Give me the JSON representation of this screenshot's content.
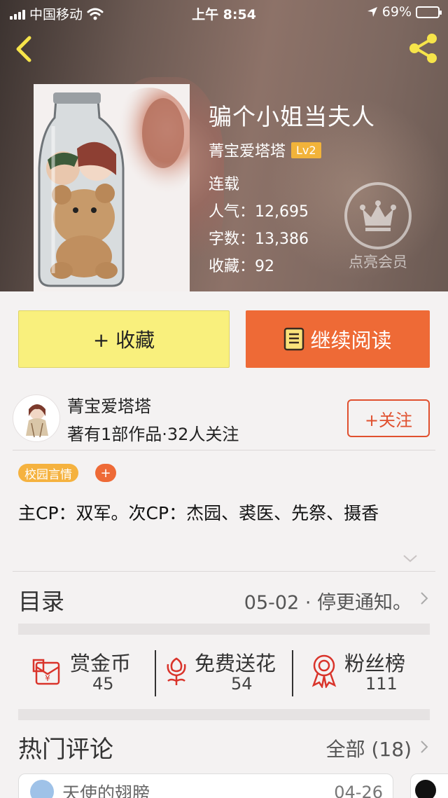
{
  "status_bar": {
    "carrier": "中国移动",
    "time": "上午 8:54",
    "battery": "69%",
    "battery_level": 0.69
  },
  "book": {
    "title": "骗个小姐当夫人",
    "author": "菁宝爱塔塔",
    "level": "Lv2",
    "status": "连载",
    "popularity_label": "人气：",
    "popularity": "12,695",
    "words_label": "字数：",
    "words": "13,386",
    "favorites_label": "收藏：",
    "favorites": "92",
    "vip_label": "点亮会员"
  },
  "actions": {
    "favorite": "+ 收藏",
    "read": "继续阅读"
  },
  "author_row": {
    "name": "菁宝爱塔塔",
    "info": "著有1部作品·32人关注",
    "follow": "+关注"
  },
  "tags": {
    "genre": "校园言情",
    "add": "+"
  },
  "description": "主CP：双军。次CP：杰园、裘医、先祭、摄香",
  "toc": {
    "label": "目录",
    "latest": "05-02 · 停更通知。"
  },
  "stats": [
    {
      "label": "赏金币",
      "value": "45",
      "icon": "red-envelope-icon"
    },
    {
      "label": "免费送花",
      "value": "54",
      "icon": "flower-icon"
    },
    {
      "label": "粉丝榜",
      "value": "111",
      "icon": "medal-icon"
    }
  ],
  "comments": {
    "title": "热门评论",
    "all": "全部 (18)",
    "first_user": "天使的翅膀",
    "first_date": "04-26"
  },
  "colors": {
    "accent_orange": "#ee6a36",
    "favorite_yellow": "#f9f07d",
    "tag_yellow": "#f5b23f",
    "follow_red": "#e0502f",
    "icon_red": "#d9342b"
  }
}
